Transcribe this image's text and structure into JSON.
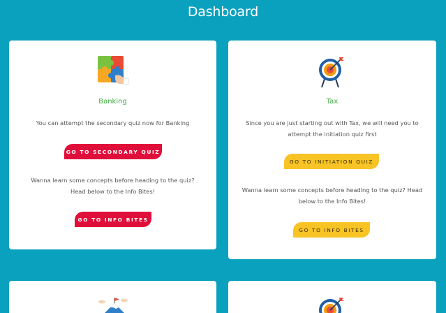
{
  "header": {
    "title": "Dashboard"
  },
  "cards": [
    {
      "title": "Banking",
      "icon": "puzzle-icon",
      "message": "You can attempt the secondary quiz now for Banking",
      "quiz_button": "GO TO SECONDARY QUIZ",
      "info_text": "Wanna learn some concepts before heading to the quiz? Head below to the Info Bites!",
      "info_button": "GO TO INFO BITES",
      "button_color": "#e00e3a"
    },
    {
      "title": "Tax",
      "icon": "target-icon",
      "message": "Since you are just starting out with Tax, we will need you to attempt the initiation quiz first",
      "quiz_button": "GO TO INITIATION QUIZ",
      "info_text": "Wanna learn some concepts before heading to the quiz? Head below to the Info Bites!",
      "info_button": "GO TO INFO BITES",
      "button_color": "#f7c325"
    },
    {
      "icon": "mountain-flag-icon"
    },
    {
      "icon": "target-icon"
    }
  ],
  "colors": {
    "background": "#0aa1bf",
    "title_green": "#3eaa3e",
    "red_button": "#e00e3a",
    "yellow_button": "#f7c325"
  }
}
